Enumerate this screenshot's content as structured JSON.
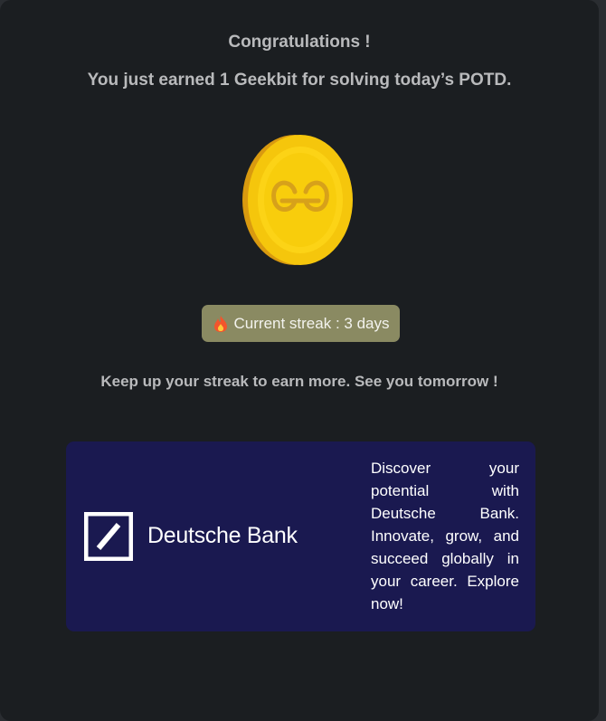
{
  "modal": {
    "title": "Congratulations !",
    "message": "You just earned 1 Geekbit for solving today’s POTD.",
    "coin_icon": "geeksforgeeks-coin-icon",
    "streak": {
      "icon": "fire-icon",
      "label": "Current streak : 3 days"
    },
    "footer_message": "Keep up your streak to earn more. See you tomorrow !"
  },
  "ad": {
    "brand": "Deutsche Bank",
    "logo_icon": "deutsche-bank-logo",
    "text": "Discover your potential with Deutsche Bank. Innovate, grow, and succeed globally in your career. Explore now!",
    "background": "#1a1950"
  },
  "colors": {
    "modal_bg": "#1b1e21",
    "text_muted": "#b9babc",
    "streak_bg": "#8a8a62",
    "coin_gold": "#f6c90e"
  }
}
